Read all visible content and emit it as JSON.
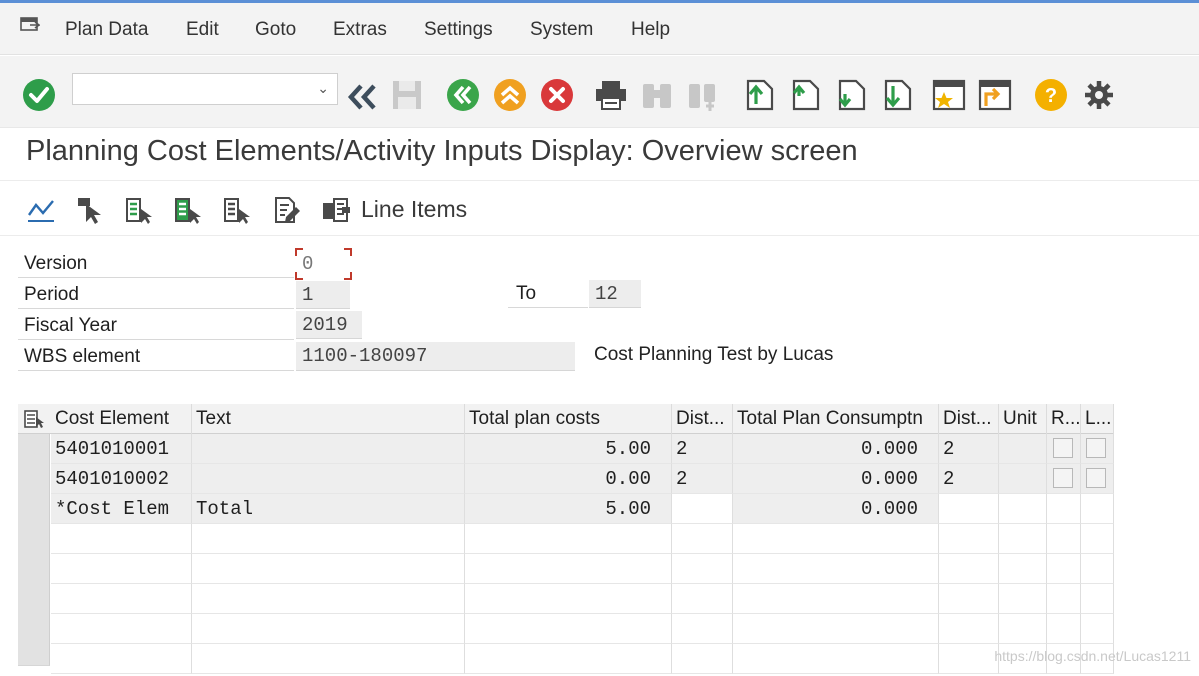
{
  "menubar": {
    "items": [
      "Plan Data",
      "Edit",
      "Goto",
      "Extras",
      "Settings",
      "System",
      "Help"
    ]
  },
  "toolbar": {
    "command_value": ""
  },
  "screen": {
    "title": "Planning Cost Elements/Activity Inputs Display: Overview screen",
    "line_items_label": "Line Items"
  },
  "header": {
    "version_label": "Version",
    "version_value": "0",
    "period_label": "Period",
    "period_from": "1",
    "to_label": "To",
    "period_to": "12",
    "fiscal_year_label": "Fiscal Year",
    "fiscal_year_value": "2019",
    "wbs_label": "WBS element",
    "wbs_value": "1100-180097",
    "wbs_description": "Cost Planning Test by Lucas"
  },
  "grid": {
    "columns": [
      "Cost Element",
      "Text",
      "Total plan costs",
      "Dist...",
      "Total Plan Consumptn",
      "Dist...",
      "Unit",
      "R...",
      "L..."
    ],
    "rows": [
      {
        "cost_element": "5401010001",
        "text": "",
        "total_plan_costs": "5.00",
        "dist1": "2",
        "total_plan_consumptn": "0.000",
        "dist2": "2",
        "unit": ""
      },
      {
        "cost_element": "5401010002",
        "text": "",
        "total_plan_costs": "0.00",
        "dist1": "2",
        "total_plan_consumptn": "0.000",
        "dist2": "2",
        "unit": ""
      },
      {
        "cost_element": "*Cost Elem",
        "text": "Total",
        "total_plan_costs": "5.00",
        "dist1": "",
        "total_plan_consumptn": "0.000",
        "dist2": "",
        "unit": ""
      }
    ]
  },
  "watermark": "https://blog.csdn.net/Lucas1211",
  "colors": {
    "ok_green": "#2e9d4a",
    "nav_green": "#3aa54a",
    "exit_orange": "#f0a020",
    "cancel_red": "#d9383a",
    "help_yellow": "#f4b000",
    "focus_red": "#c0392b"
  }
}
